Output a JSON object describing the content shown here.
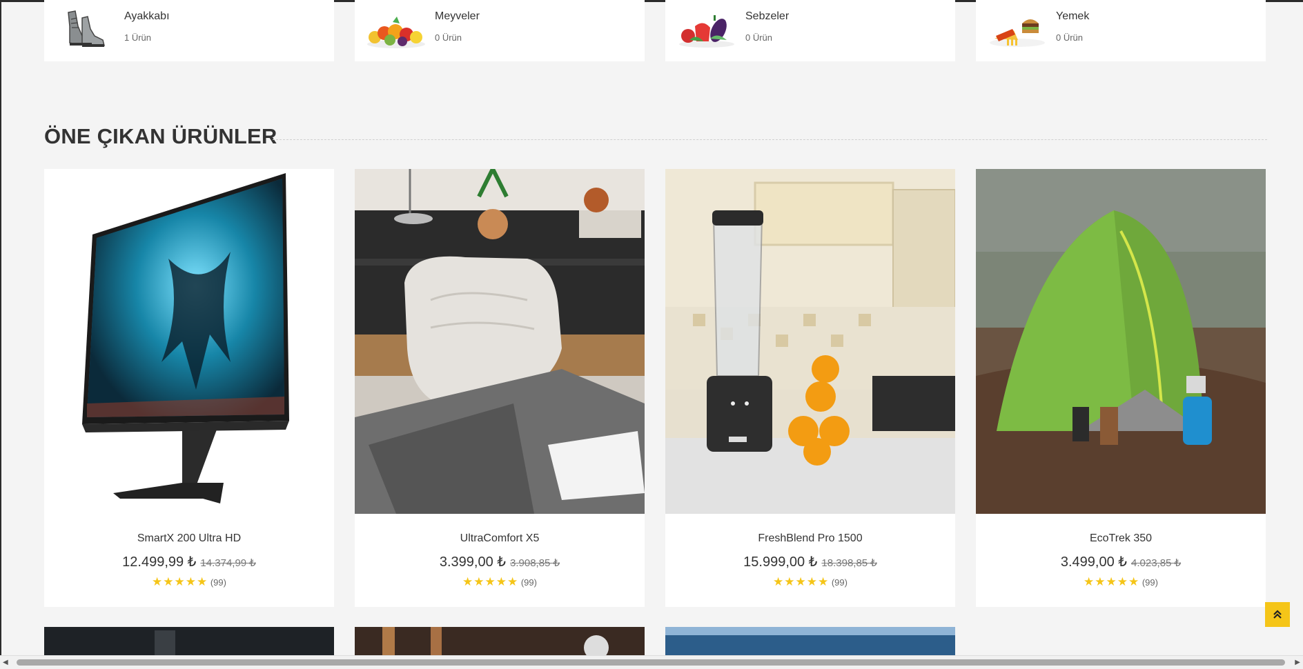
{
  "categories": [
    {
      "title": "Ayakkabı",
      "count": "1 Ürün",
      "icon": "shoes-image"
    },
    {
      "title": "Meyveler",
      "count": "0 Ürün",
      "icon": "fruits-image"
    },
    {
      "title": "Sebzeler",
      "count": "0 Ürün",
      "icon": "vegetables-image"
    },
    {
      "title": "Yemek",
      "count": "0 Ürün",
      "icon": "food-image"
    }
  ],
  "featured": {
    "title": "ÖNE ÇIKAN ÜRÜNLER",
    "products": [
      {
        "name": "SmartX 200 Ultra HD",
        "price": "12.499,99 ₺",
        "old_price": "14.374,99 ₺",
        "stars": "★★★★★",
        "reviews": "(99)"
      },
      {
        "name": "UltraComfort X5",
        "price": "3.399,00 ₺",
        "old_price": "3.908,85 ₺",
        "stars": "★★★★★",
        "reviews": "(99)"
      },
      {
        "name": "FreshBlend Pro 1500",
        "price": "15.999,00 ₺",
        "old_price": "18.398,85 ₺",
        "stars": "★★★★★",
        "reviews": "(99)"
      },
      {
        "name": "EcoTrek 350",
        "price": "3.499,00 ₺",
        "old_price": "4.023,85 ₺",
        "stars": "★★★★★",
        "reviews": "(99)"
      }
    ]
  },
  "colors": {
    "accent": "#f5c518",
    "background": "#f4f4f4",
    "card": "#ffffff"
  },
  "scroll_top_icon": "double-chevron-up-icon"
}
